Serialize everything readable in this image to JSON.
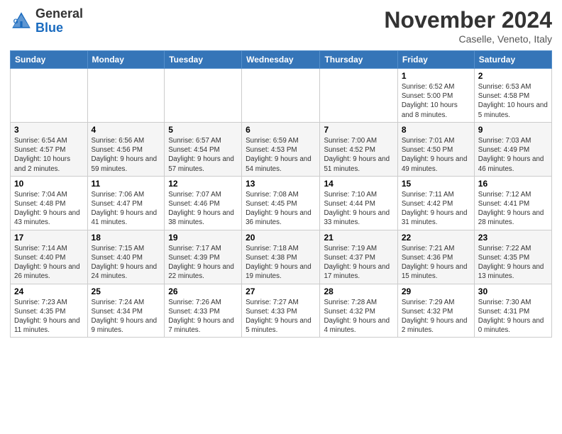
{
  "logo": {
    "general": "General",
    "blue": "Blue"
  },
  "title": "November 2024",
  "location": "Caselle, Veneto, Italy",
  "days_of_week": [
    "Sunday",
    "Monday",
    "Tuesday",
    "Wednesday",
    "Thursday",
    "Friday",
    "Saturday"
  ],
  "weeks": [
    [
      {
        "day": "",
        "info": ""
      },
      {
        "day": "",
        "info": ""
      },
      {
        "day": "",
        "info": ""
      },
      {
        "day": "",
        "info": ""
      },
      {
        "day": "",
        "info": ""
      },
      {
        "day": "1",
        "info": "Sunrise: 6:52 AM\nSunset: 5:00 PM\nDaylight: 10 hours\nand 8 minutes."
      },
      {
        "day": "2",
        "info": "Sunrise: 6:53 AM\nSunset: 4:58 PM\nDaylight: 10 hours\nand 5 minutes."
      }
    ],
    [
      {
        "day": "3",
        "info": "Sunrise: 6:54 AM\nSunset: 4:57 PM\nDaylight: 10 hours\nand 2 minutes."
      },
      {
        "day": "4",
        "info": "Sunrise: 6:56 AM\nSunset: 4:56 PM\nDaylight: 9 hours\nand 59 minutes."
      },
      {
        "day": "5",
        "info": "Sunrise: 6:57 AM\nSunset: 4:54 PM\nDaylight: 9 hours\nand 57 minutes."
      },
      {
        "day": "6",
        "info": "Sunrise: 6:59 AM\nSunset: 4:53 PM\nDaylight: 9 hours\nand 54 minutes."
      },
      {
        "day": "7",
        "info": "Sunrise: 7:00 AM\nSunset: 4:52 PM\nDaylight: 9 hours\nand 51 minutes."
      },
      {
        "day": "8",
        "info": "Sunrise: 7:01 AM\nSunset: 4:50 PM\nDaylight: 9 hours\nand 49 minutes."
      },
      {
        "day": "9",
        "info": "Sunrise: 7:03 AM\nSunset: 4:49 PM\nDaylight: 9 hours\nand 46 minutes."
      }
    ],
    [
      {
        "day": "10",
        "info": "Sunrise: 7:04 AM\nSunset: 4:48 PM\nDaylight: 9 hours\nand 43 minutes."
      },
      {
        "day": "11",
        "info": "Sunrise: 7:06 AM\nSunset: 4:47 PM\nDaylight: 9 hours\nand 41 minutes."
      },
      {
        "day": "12",
        "info": "Sunrise: 7:07 AM\nSunset: 4:46 PM\nDaylight: 9 hours\nand 38 minutes."
      },
      {
        "day": "13",
        "info": "Sunrise: 7:08 AM\nSunset: 4:45 PM\nDaylight: 9 hours\nand 36 minutes."
      },
      {
        "day": "14",
        "info": "Sunrise: 7:10 AM\nSunset: 4:44 PM\nDaylight: 9 hours\nand 33 minutes."
      },
      {
        "day": "15",
        "info": "Sunrise: 7:11 AM\nSunset: 4:42 PM\nDaylight: 9 hours\nand 31 minutes."
      },
      {
        "day": "16",
        "info": "Sunrise: 7:12 AM\nSunset: 4:41 PM\nDaylight: 9 hours\nand 28 minutes."
      }
    ],
    [
      {
        "day": "17",
        "info": "Sunrise: 7:14 AM\nSunset: 4:40 PM\nDaylight: 9 hours\nand 26 minutes."
      },
      {
        "day": "18",
        "info": "Sunrise: 7:15 AM\nSunset: 4:40 PM\nDaylight: 9 hours\nand 24 minutes."
      },
      {
        "day": "19",
        "info": "Sunrise: 7:17 AM\nSunset: 4:39 PM\nDaylight: 9 hours\nand 22 minutes."
      },
      {
        "day": "20",
        "info": "Sunrise: 7:18 AM\nSunset: 4:38 PM\nDaylight: 9 hours\nand 19 minutes."
      },
      {
        "day": "21",
        "info": "Sunrise: 7:19 AM\nSunset: 4:37 PM\nDaylight: 9 hours\nand 17 minutes."
      },
      {
        "day": "22",
        "info": "Sunrise: 7:21 AM\nSunset: 4:36 PM\nDaylight: 9 hours\nand 15 minutes."
      },
      {
        "day": "23",
        "info": "Sunrise: 7:22 AM\nSunset: 4:35 PM\nDaylight: 9 hours\nand 13 minutes."
      }
    ],
    [
      {
        "day": "24",
        "info": "Sunrise: 7:23 AM\nSunset: 4:35 PM\nDaylight: 9 hours\nand 11 minutes."
      },
      {
        "day": "25",
        "info": "Sunrise: 7:24 AM\nSunset: 4:34 PM\nDaylight: 9 hours\nand 9 minutes."
      },
      {
        "day": "26",
        "info": "Sunrise: 7:26 AM\nSunset: 4:33 PM\nDaylight: 9 hours\nand 7 minutes."
      },
      {
        "day": "27",
        "info": "Sunrise: 7:27 AM\nSunset: 4:33 PM\nDaylight: 9 hours\nand 5 minutes."
      },
      {
        "day": "28",
        "info": "Sunrise: 7:28 AM\nSunset: 4:32 PM\nDaylight: 9 hours\nand 4 minutes."
      },
      {
        "day": "29",
        "info": "Sunrise: 7:29 AM\nSunset: 4:32 PM\nDaylight: 9 hours\nand 2 minutes."
      },
      {
        "day": "30",
        "info": "Sunrise: 7:30 AM\nSunset: 4:31 PM\nDaylight: 9 hours\nand 0 minutes."
      }
    ]
  ]
}
